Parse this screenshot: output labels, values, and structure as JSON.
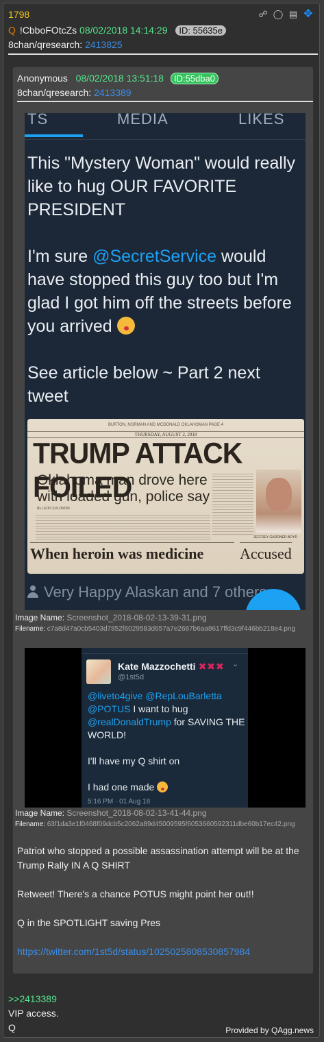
{
  "post": {
    "number": "1798",
    "q_mark": "Q",
    "tripcode": "!CbboFOtcZs",
    "date": "08/02/2018 14:14:29",
    "id_label": "ID: 55635e",
    "board": "8chan/qresearch:",
    "board_link": "2413825",
    "icons": [
      "share-icon",
      "glasses-icon",
      "document-icon",
      "move-icon"
    ]
  },
  "quoted": {
    "author": "Anonymous",
    "date": "08/02/2018 13:51:18",
    "id_label": "ID:55dba0",
    "board": "8chan/qresearch:",
    "board_link": "2413389",
    "image1": {
      "tabs": [
        "TS",
        "MEDIA",
        "LIKES"
      ],
      "text_line1": "This \"Mystery Woman\" would really like to hug OUR FAVORITE PRESIDENT",
      "text_2a": "I'm sure ",
      "text_2_mention": "@SecretService",
      "text_2b": " would have stopped this guy too but I'm glad I got him off the streets before you arrived ",
      "text_3": "See article below ~ Part 2 next tweet",
      "newspaper": {
        "top_line": "BURTON, NORMAN AND MCDONALD OKLAHOMAN PAGE 4",
        "date_line": "THURSDAY, AUGUST 2, 2018",
        "headline": "TRUMP ATTACK FOILED",
        "subhead": "Oklahoma man drove here with loaded gun, police say",
        "byline": "By LEON SOLOMON",
        "mug_caption": "JEFFREY GARDNER BOYD",
        "heroin_headline": "When heroin was medicine",
        "accused": "Accused"
      },
      "liked_by": "Very Happy Alaskan and 7 others"
    },
    "image1_meta": {
      "name_label": "Image Name:",
      "name_value": "Screenshot_2018-08-02-13-39-31.png",
      "file_label": "Filename:",
      "file_value": "c7a8d47a0cb5403d7852f6029583d657a7e2687b6aa8617ffd3c9f446bb218e4.png"
    },
    "image2": {
      "name": "Kate Mazzochetti",
      "marks": "✖✖✖",
      "handle": "@1st5d",
      "mentions_1": "@livetо4give @RepLouBarletta @POTUS",
      "text_1": " I want to hug ",
      "mention_2": "@realDonaldTrump",
      "text_2": " for SAVING THE WORLD!",
      "text_3": "I'll have my Q shirt on",
      "text_4": "I had one made ",
      "time": "5:16 PM · 01 Aug 18"
    },
    "image2_meta": {
      "name_label": "Image Name:",
      "name_value": "Screenshot_2018-08-02-13-41-44.png",
      "file_label": "Filename:",
      "file_value": "63f1da3e1f0468f09dcb5c2062a89d45009595f6053660592311dbe60b17ec42.png"
    },
    "body": {
      "p1": "Patriot who stopped a possible assassination attempt will be at the Trump Rally IN A Q SHIRT",
      "p2": "Retweet!  There's a chance POTUS might point her out!!",
      "p3": "Q in the SPOTLIGHT saving Pres",
      "link": "https://twitter.com/1st5d/status/1025025808530857984"
    }
  },
  "reply": {
    "ref": ">>2413389",
    "line1": "VIP access.",
    "line2": "Q"
  },
  "footer": "Provided by QAgg.news"
}
